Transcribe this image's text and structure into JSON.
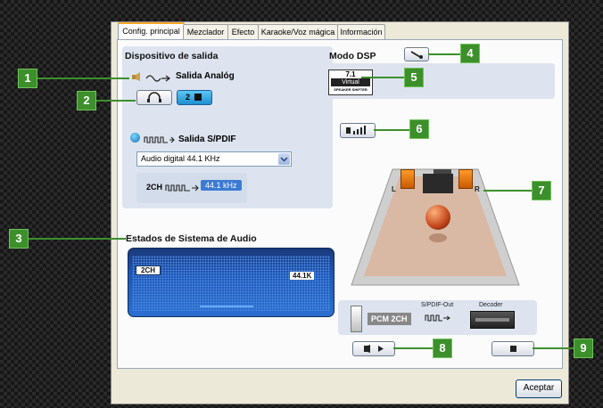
{
  "tabs": [
    {
      "label": "Config. principal"
    },
    {
      "label": "Mezclador"
    },
    {
      "label": "Efecto"
    },
    {
      "label": "Karaoke/Voz mágica"
    },
    {
      "label": "Información"
    }
  ],
  "output": {
    "heading": "Dispositivo de salida",
    "analog_label": "Salida Analóg",
    "speaker_count": "2",
    "spdif_label": "Salida S/PDIF",
    "spdif_select": "Audio digital 44.1 KHz",
    "channel": "2CH",
    "rate": "44.1 kHz"
  },
  "status": {
    "heading": "Estados de Sistema de Audio",
    "channel": "2CH",
    "rate": "44.1K"
  },
  "dsp": {
    "heading": "Modo DSP",
    "virtual_top": "7.1",
    "virtual_mid": "Virtual",
    "virtual_bottom": "SPEAKER SHIFTER",
    "left": "L",
    "right": "R",
    "spdif_out": "S/PDIF-Out",
    "decoder": "Decoder",
    "pcm": "PCM 2CH"
  },
  "footer": {
    "accept": "Aceptar"
  },
  "callouts": [
    "1",
    "2",
    "3",
    "4",
    "5",
    "6",
    "7",
    "8",
    "9"
  ]
}
